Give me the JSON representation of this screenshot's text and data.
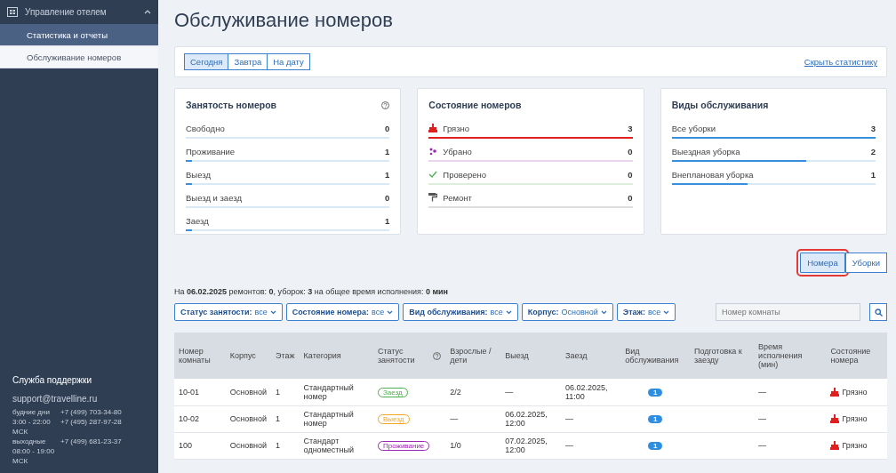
{
  "sidebar": {
    "section": {
      "title": "Управление отелем",
      "expanded": true
    },
    "items": [
      {
        "label": "Статистика и отчеты",
        "selected": true
      },
      {
        "label": "Обслуживание номеров",
        "selected": false
      }
    ],
    "support": {
      "title": "Служба поддержки",
      "email": "support@travelline.ru",
      "rows": [
        {
          "label": "будние дни",
          "phone": "+7 (499) 703-34-80"
        },
        {
          "label": "3:00 - 22:00 МСК",
          "phone": "+7 (495) 287-97-28"
        },
        {
          "label": "выходные 08:00 - 19:00 МСК",
          "phone": "+7 (499) 681-23-37"
        }
      ]
    }
  },
  "page_title": "Обслуживание номеров",
  "date_tabs": [
    {
      "label": "Сегодня",
      "selected": true
    },
    {
      "label": "Завтра",
      "selected": false
    },
    {
      "label": "На дату",
      "selected": false
    }
  ],
  "hide_stats_link": "Скрыть статистику",
  "cards": [
    {
      "title": "Занятость номеров",
      "help": true,
      "rows": [
        {
          "label": "Свободно",
          "value": "0",
          "level": 0
        },
        {
          "label": "Проживание",
          "value": "1",
          "level": 0.03
        },
        {
          "label": "Выезд",
          "value": "1",
          "level": 0.03
        },
        {
          "label": "Выезд и заезд",
          "value": "0",
          "level": 0
        },
        {
          "label": "Заезд",
          "value": "1",
          "level": 0.03
        }
      ]
    },
    {
      "title": "Состояние номеров",
      "rows": [
        {
          "label": "Грязно",
          "value": "3",
          "level": 1,
          "kind": "dirty",
          "color": "#e02020"
        },
        {
          "label": "Убрано",
          "value": "0",
          "level": 0,
          "kind": "cleaned",
          "color": "#9c27b0"
        },
        {
          "label": "Проверено",
          "value": "0",
          "level": 0,
          "kind": "checked",
          "color": "#4caf50"
        },
        {
          "label": "Ремонт",
          "value": "0",
          "level": 0,
          "kind": "repair",
          "color": "#555555"
        }
      ]
    },
    {
      "title": "Виды обслуживания",
      "rows": [
        {
          "label": "Все уборки",
          "value": "3",
          "level": 1
        },
        {
          "label": "Выездная уборка",
          "value": "2",
          "level": 0.66
        },
        {
          "label": "Внеплановая уборка",
          "value": "1",
          "level": 0.37
        }
      ]
    }
  ],
  "view_buttons": [
    {
      "label": "Номера",
      "selected": true,
      "highlighted": true
    },
    {
      "label": "Уборки",
      "selected": false,
      "highlighted": false
    }
  ],
  "summary": "На **06.02.2025** ремонтов: **0**, уборок: **3** на общее время исполнения: **0 мин**",
  "filters": [
    {
      "label": "Статус занятости:",
      "value": "все"
    },
    {
      "label": "Состояние номера:",
      "value": "все"
    },
    {
      "label": "Вид обслуживания:",
      "value": "все"
    },
    {
      "label": "Корпус:",
      "value": "Основной"
    },
    {
      "label": "Этаж:",
      "value": "все"
    }
  ],
  "room_search": {
    "placeholder": "Номер комнаты"
  },
  "table": {
    "columns": [
      {
        "label": "Номер комнаты"
      },
      {
        "label": "Корпус"
      },
      {
        "label": "Этаж"
      },
      {
        "label": "Категория"
      },
      {
        "label": "Статус занятости",
        "help": true
      },
      {
        "label": "Взрослые / дети"
      },
      {
        "label": "Выезд"
      },
      {
        "label": "Заезд"
      },
      {
        "label": "Вид обслуживания"
      },
      {
        "label": "Подготовка к заезду"
      },
      {
        "label": "Время исполнения (мин)"
      },
      {
        "label": "Состояние номера"
      }
    ],
    "rows": [
      {
        "room": "10-01",
        "building": "Основной",
        "floor": "1",
        "category": "Стандартный номер",
        "status": {
          "label": "Заезд",
          "color": "#4caf50"
        },
        "guests": "2/2",
        "departure": "—",
        "arrival": "06.02.2025, 11:00",
        "service_count": "1",
        "time": "—",
        "state": "Грязно"
      },
      {
        "room": "10-02",
        "building": "Основной",
        "floor": "1",
        "category": "Стандартный номер",
        "status": {
          "label": "Выезд",
          "color": "#f5a623"
        },
        "guests": "—",
        "departure": "06.02.2025, 12:00",
        "arrival": "—",
        "service_count": "1",
        "time": "—",
        "state": "Грязно"
      },
      {
        "room": "100",
        "building": "Основной",
        "floor": "1",
        "category": "Стандарт одноместный",
        "status": {
          "label": "Проживание",
          "color": "#9c27b0"
        },
        "guests": "1/0",
        "departure": "07.02.2025, 12:00",
        "arrival": "—",
        "service_count": "1",
        "time": "—",
        "state": "Грязно"
      }
    ]
  }
}
